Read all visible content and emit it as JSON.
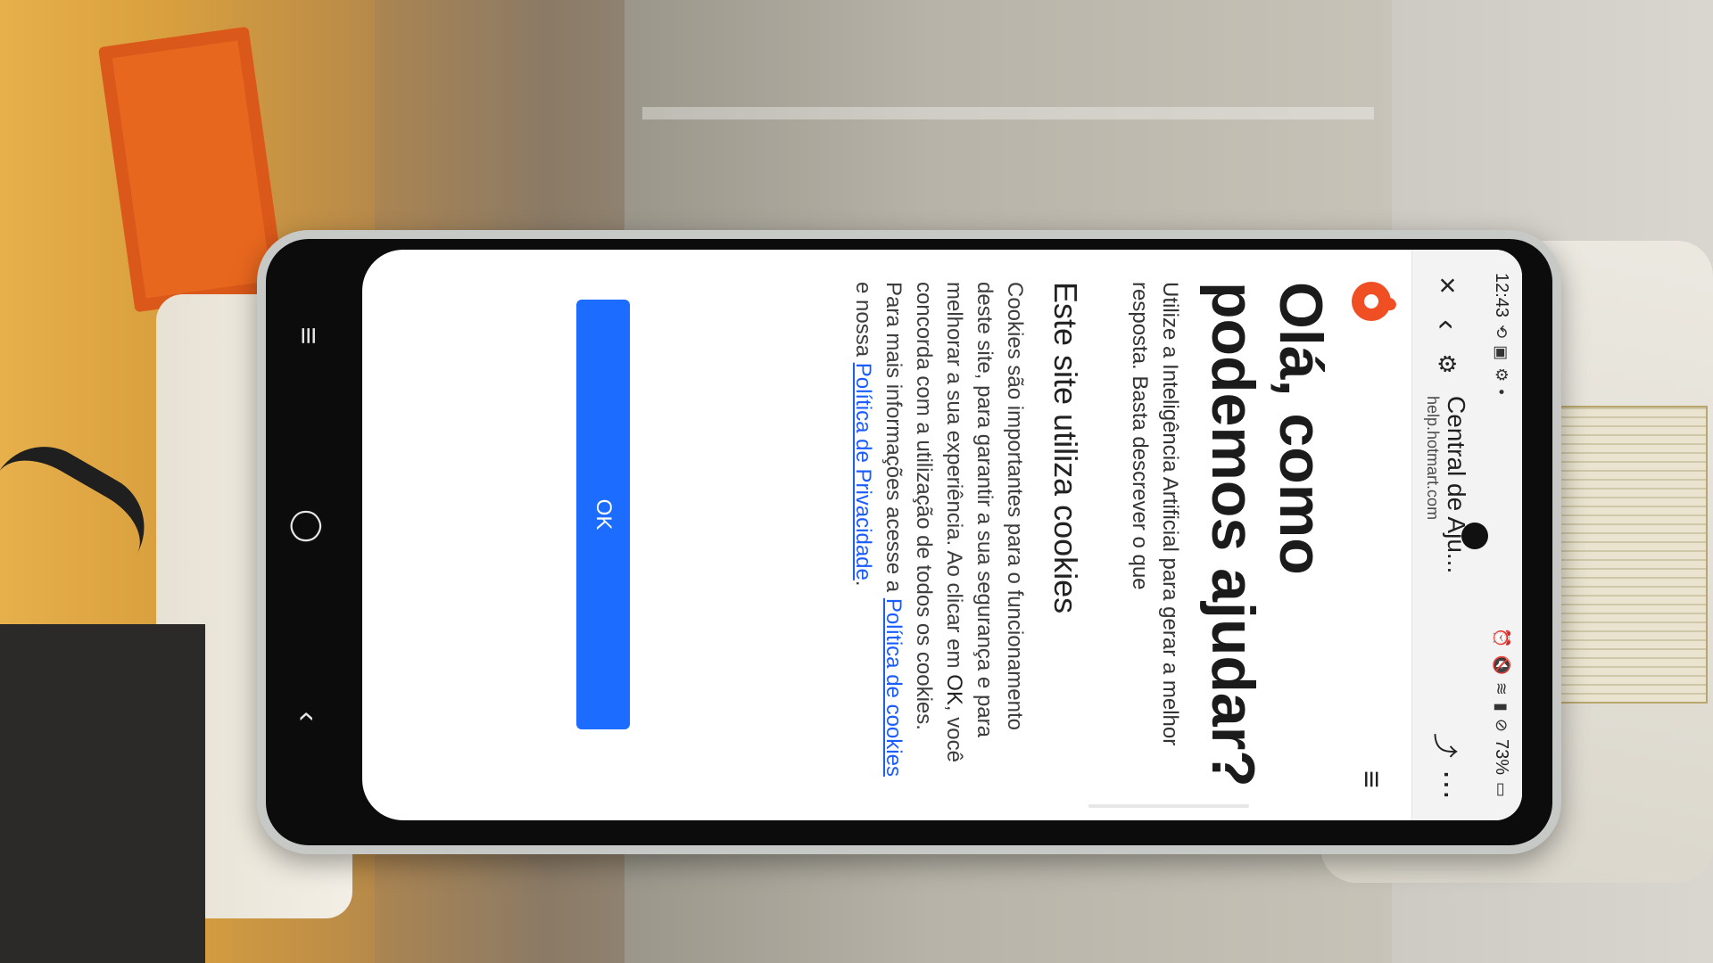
{
  "status_bar": {
    "time": "12:43",
    "left_icons": [
      "sync-icon",
      "image-icon",
      "gear-icon",
      "dot-icon"
    ],
    "right_icons": [
      "alarm-icon",
      "mute-icon",
      "wifi-icon",
      "signal-icon",
      "no-disturb-icon"
    ],
    "battery": "73%"
  },
  "browser": {
    "close_icon": "×",
    "back_icon": "‹",
    "tune_icon": "⚙",
    "title": "Central de Aju...",
    "url": "help.hotmart.com",
    "share_icon": "⤴",
    "more_icon": "⋯"
  },
  "page": {
    "menu_icon": "≡",
    "heading": "Olá, como podemos ajudar?",
    "intro": "Utilize a Inteligência Artificial para gerar a melhor resposta. Basta descrever o que",
    "cookie_title": "Este site utiliza cookies",
    "cookie_text_1": "Cookies são importantes para o funcionamento deste site, para garantir a sua segurança e para melhorar a sua experiência. Ao clicar em ",
    "cookie_ok_word": "OK",
    "cookie_text_2": ", você concorda com a utilização de todos os cookies. Para mais informações acesse a ",
    "cookie_link_1": "Política de cookies",
    "cookie_text_3": " e nossa ",
    "cookie_link_2": "Política de Privacidade",
    "cookie_text_4": ".",
    "ok_button": "OK"
  },
  "android_nav": {
    "recents": "≡",
    "home": "◯",
    "back": "‹"
  },
  "colors": {
    "brand": "#f04e23",
    "button": "#1c6dff",
    "link": "#1a5cff"
  }
}
